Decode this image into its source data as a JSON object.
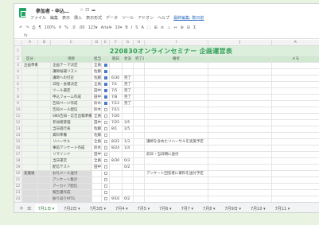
{
  "app": {
    "title": "參加者・申込…",
    "title_icons": "☆ ⊡ ☁",
    "menus": [
      "ファイル",
      "編集",
      "表示",
      "挿入",
      "表示形式",
      "データ",
      "ツール",
      "アドオン",
      "ヘルプ"
    ],
    "last_edit": "最終編集: 数日前"
  },
  "toolbar": {
    "items": [
      "↶",
      "↷",
      "⎙",
      "¶",
      "100%",
      "¥",
      "%",
      ".0",
      ".00",
      "123▾",
      "Arial▾",
      "10▾",
      "B",
      "I",
      "S",
      "A",
      "⬚",
      "⊞",
      "≡",
      "⊥",
      "↔",
      "⊕",
      "⊟",
      "Σ"
    ]
  },
  "fxbar": {
    "cell_ref": "fx",
    "value": ""
  },
  "columns": [
    "",
    "A",
    "B",
    "C",
    "D",
    "E",
    "F",
    "G",
    "H",
    "I",
    "J",
    "K"
  ],
  "sheet_title": "220830オンラインセミナー 企画運営表",
  "header_row": [
    "",
    "区分",
    "",
    "項目",
    "担当",
    "",
    "期日",
    "状況",
    "完了日",
    "備考",
    "",
    "メモ"
  ],
  "rows": [
    {
      "n": "3",
      "sec": "light",
      "a": "企画準備",
      "c": "企画テーマ決定",
      "d": "全員",
      "e": "on",
      "f": "",
      "g": "",
      "h": "",
      "i": "",
      "j": "",
      "k": ""
    },
    {
      "n": "4",
      "sec": "light",
      "a": "",
      "c": "講師候補リスト",
      "d": "佐藤",
      "e": "on",
      "f": "",
      "g": "",
      "h": "",
      "i": "",
      "j": "",
      "k": ""
    },
    {
      "n": "5",
      "sec": "light",
      "a": "",
      "c": "講師への打診",
      "d": "佐藤",
      "e": "on",
      "f": "6/30",
      "g": "完了",
      "h": "",
      "i": "",
      "j": "",
      "k": ""
    },
    {
      "n": "6",
      "sec": "light",
      "a": "",
      "c": "日程・会場決定",
      "d": "全員",
      "e": "on",
      "f": "7/1",
      "g": "完了",
      "h": "",
      "i": "",
      "j": "",
      "k": ""
    },
    {
      "n": "7",
      "sec": "light",
      "a": "",
      "c": "ツール選定",
      "d": "田中",
      "e": "on",
      "f": "7/5",
      "g": "完了",
      "h": "",
      "i": "",
      "j": "",
      "k": ""
    },
    {
      "n": "8",
      "sec": "light",
      "a": "",
      "c": "申込フォーム作成",
      "d": "田中",
      "e": "on",
      "f": "7/8",
      "g": "完了",
      "h": "",
      "i": "",
      "j": "",
      "k": ""
    },
    {
      "n": "9",
      "sec": "light",
      "a": "",
      "c": "告知ページ作成",
      "d": "鈴木",
      "e": "on",
      "f": "7/12",
      "g": "完了",
      "h": "",
      "i": "",
      "j": "",
      "k": ""
    },
    {
      "n": "10",
      "sec": "light",
      "a": "",
      "c": "告知メール配信",
      "d": "鈴木",
      "e": "off",
      "f": "7/15",
      "g": "",
      "h": "",
      "i": "",
      "j": "",
      "k": ""
    },
    {
      "n": "11",
      "sec": "light",
      "a": "",
      "c": "SNS告知・広告出稿準備",
      "d": "全員",
      "e": "off",
      "f": "7/20",
      "g": "",
      "h": "",
      "i": "",
      "j": "",
      "k": ""
    },
    {
      "n": "12",
      "sec": "light",
      "a": "",
      "c": "参加者管理",
      "d": "田中",
      "e": "off",
      "f": "7/25",
      "g": "3/5",
      "h": "",
      "i": "",
      "j": "",
      "k": ""
    },
    {
      "n": "13",
      "sec": "light",
      "a": "",
      "c": "当日進行表",
      "d": "佐藤",
      "e": "off",
      "f": "8/1",
      "g": "2/5",
      "h": "",
      "i": "",
      "j": "",
      "k": ""
    },
    {
      "n": "14",
      "sec": "light",
      "a": "",
      "c": "資料準備",
      "d": "佐藤",
      "e": "off",
      "f": "",
      "g": "",
      "h": "",
      "i": "",
      "j": "",
      "k": ""
    },
    {
      "n": "15",
      "sec": "light",
      "a": "",
      "c": "リハーサル",
      "d": "全員",
      "e": "off",
      "f": "8/22",
      "g": "1/3",
      "h": "",
      "i": "講師を含めたリハーサルを実施予定",
      "j": "",
      "k": ""
    },
    {
      "n": "16",
      "sec": "light",
      "a": "",
      "c": "事前アンケート作成",
      "d": "鈴木",
      "e": "off",
      "f": "8/24",
      "g": "1/4",
      "h": "",
      "i": "",
      "j": "",
      "k": ""
    },
    {
      "n": "17",
      "sec": "light",
      "a": "",
      "c": "リマインド",
      "d": "田中",
      "e": "off",
      "f": "",
      "g": "",
      "h": "",
      "i": "前日・当日朝に送付",
      "j": "",
      "k": ""
    },
    {
      "n": "18",
      "sec": "light",
      "a": "",
      "c": "当日運営",
      "d": "全員",
      "e": "off",
      "f": "8/30",
      "g": "0/3",
      "h": "",
      "i": "",
      "j": "",
      "k": ""
    },
    {
      "n": "19",
      "sec": "light",
      "a": "",
      "c": "配信テスト",
      "d": "田中",
      "e": "off",
      "f": "",
      "g": "0/2",
      "h": "",
      "i": "",
      "j": "",
      "k": ""
    },
    {
      "n": "20",
      "sec": "dark",
      "a": "実施後",
      "c": "お礼メール送付",
      "d": "",
      "e": "off",
      "f": "",
      "g": "",
      "h": "",
      "i": "アンケート回答者に資料を送付予定",
      "j": "",
      "k": ""
    },
    {
      "n": "21",
      "sec": "dark",
      "a": "",
      "c": "アンケート集計",
      "d": "",
      "e": "off",
      "f": "",
      "g": "",
      "h": "",
      "i": "",
      "j": "",
      "k": ""
    },
    {
      "n": "22",
      "sec": "dark",
      "a": "",
      "c": "アーカイブ配信",
      "d": "",
      "e": "off",
      "f": "",
      "g": "",
      "h": "",
      "i": "",
      "j": "",
      "k": ""
    },
    {
      "n": "23",
      "sec": "dark",
      "a": "",
      "c": "報告書作成",
      "d": "",
      "e": "off",
      "f": "",
      "g": "",
      "h": "",
      "i": "",
      "j": "",
      "k": ""
    },
    {
      "n": "24",
      "sec": "dark",
      "a": "",
      "c": "振り返りMTG",
      "d": "",
      "e": "off",
      "f": "9/10",
      "g": "0/2",
      "h": "",
      "i": "",
      "j": "",
      "k": ""
    },
    {
      "n": "25",
      "sec": "dark",
      "a": "",
      "c": "次回企画案",
      "d": "",
      "e": "off",
      "f": "9/15",
      "g": "0/1",
      "h": "",
      "i": "",
      "j": "",
      "k": ""
    },
    {
      "n": "26",
      "sec": "dark",
      "a": "",
      "c": "予算精算",
      "d": "",
      "e": "off",
      "f": "9/20",
      "g": "0/1",
      "h": "",
      "i": "",
      "j": "",
      "k": ""
    }
  ],
  "tabs": [
    "+",
    "≡",
    "7月1日 ▾",
    "7月2日 ▾",
    "7月3日 ▾",
    "7月4 ▾",
    "7月5 ▾",
    "7月6 ▾",
    "7月7 ▾",
    "7月8 ▾",
    "7月9日 ▾",
    "7月10 ▾",
    "7月11 ▾"
  ],
  "active_tab": 2
}
